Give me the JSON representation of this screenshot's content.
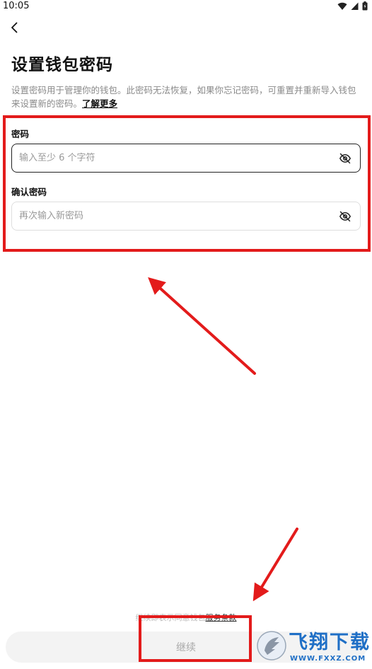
{
  "status_bar": {
    "time": "10:05"
  },
  "page": {
    "title": "设置钱包密码",
    "description": "设置密码用于管理你的钱包。此密码无法恢复，如果你忘记密码，可重置并重新导入钱包来设置新的密码。",
    "learn_more": "了解更多"
  },
  "form": {
    "password": {
      "label": "密码",
      "placeholder": "输入至少 6 个字符",
      "value": ""
    },
    "confirm": {
      "label": "确认密码",
      "placeholder": "再次输入新密码",
      "value": ""
    }
  },
  "footer": {
    "terms_prefix": "继续即表示同意钱包",
    "terms_link": "服务条款",
    "continue_label": "继续"
  },
  "watermark": {
    "cn": "飞翔下载",
    "en": "WWW.FXXZ.COM"
  },
  "icons": [
    "back-arrow-icon",
    "eye-off-icon",
    "wifi-icon",
    "signal-icon",
    "battery-icon"
  ],
  "colors": {
    "annotation": "#e31b1b",
    "brand_watermark": "#1f6fc6"
  }
}
